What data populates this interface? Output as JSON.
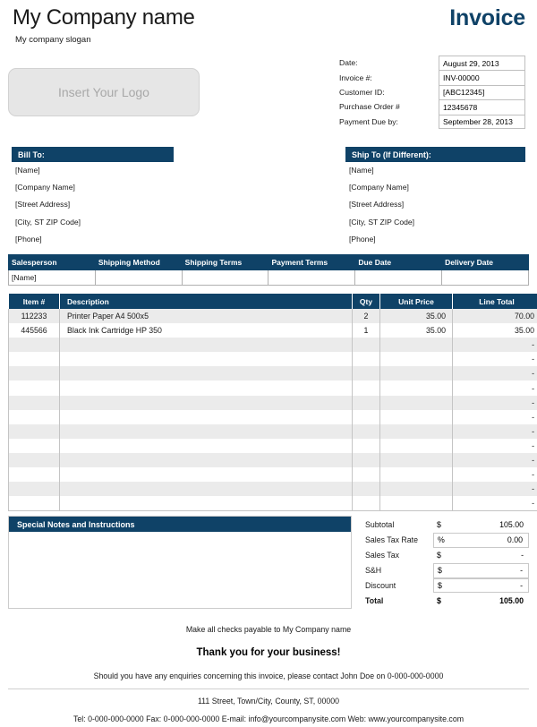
{
  "header": {
    "company_name": "My Company name",
    "company_slogan": "My company slogan",
    "logo_placeholder": "Insert Your Logo",
    "invoice_title": "Invoice"
  },
  "meta": {
    "rows": [
      {
        "label": "Date:",
        "value": "August 29, 2013"
      },
      {
        "label": "Invoice #:",
        "value": "INV-00000"
      },
      {
        "label": "Customer ID:",
        "value": "[ABC12345]"
      },
      {
        "label": "Purchase Order #",
        "value": "12345678"
      },
      {
        "label": "Payment Due by:",
        "value": "September 28, 2013"
      }
    ]
  },
  "bill_to": {
    "heading": "Bill To:",
    "lines": [
      "[Name]",
      "[Company Name]",
      "[Street Address]",
      "[City, ST  ZIP Code]",
      "[Phone]"
    ]
  },
  "ship_to": {
    "heading": "Ship To (If Different):",
    "lines": [
      "[Name]",
      "[Company Name]",
      "[Street Address]",
      "[City, ST  ZIP Code]",
      "[Phone]"
    ]
  },
  "terms": {
    "headers": [
      "Salesperson",
      "Shipping Method",
      "Shipping Terms",
      "Payment Terms",
      "Due Date",
      "Delivery Date"
    ],
    "row": [
      "[Name]",
      "",
      "",
      "",
      "",
      ""
    ]
  },
  "items": {
    "headers": {
      "item": "Item #",
      "description": "Description",
      "qty": "Qty",
      "unit_price": "Unit Price",
      "line_total": "Line Total"
    },
    "rows": [
      {
        "item": "112233",
        "description": "Printer Paper A4 500x5",
        "qty": "2",
        "unit_price": "35.00",
        "line_total": "70.00"
      },
      {
        "item": "445566",
        "description": "Black Ink Cartridge HP 350",
        "qty": "1",
        "unit_price": "35.00",
        "line_total": "35.00"
      },
      {
        "item": "",
        "description": "",
        "qty": "",
        "unit_price": "",
        "line_total": "-"
      },
      {
        "item": "",
        "description": "",
        "qty": "",
        "unit_price": "",
        "line_total": "-"
      },
      {
        "item": "",
        "description": "",
        "qty": "",
        "unit_price": "",
        "line_total": "-"
      },
      {
        "item": "",
        "description": "",
        "qty": "",
        "unit_price": "",
        "line_total": "-"
      },
      {
        "item": "",
        "description": "",
        "qty": "",
        "unit_price": "",
        "line_total": "-"
      },
      {
        "item": "",
        "description": "",
        "qty": "",
        "unit_price": "",
        "line_total": "-"
      },
      {
        "item": "",
        "description": "",
        "qty": "",
        "unit_price": "",
        "line_total": "-"
      },
      {
        "item": "",
        "description": "",
        "qty": "",
        "unit_price": "",
        "line_total": "-"
      },
      {
        "item": "",
        "description": "",
        "qty": "",
        "unit_price": "",
        "line_total": "-"
      },
      {
        "item": "",
        "description": "",
        "qty": "",
        "unit_price": "",
        "line_total": "-"
      },
      {
        "item": "",
        "description": "",
        "qty": "",
        "unit_price": "",
        "line_total": "-"
      },
      {
        "item": "",
        "description": "",
        "qty": "",
        "unit_price": "",
        "line_total": "-"
      }
    ]
  },
  "notes": {
    "heading": "Special Notes and Instructions",
    "body": ""
  },
  "totals": {
    "rows": [
      {
        "label": "Subtotal",
        "symbol": "$",
        "amount": "105.00",
        "boxed": false,
        "grand": false
      },
      {
        "label": "Sales Tax Rate",
        "symbol": "%",
        "amount": "0.00",
        "boxed": true,
        "grand": false
      },
      {
        "label": "Sales Tax",
        "symbol": "$",
        "amount": "-",
        "boxed": false,
        "grand": false
      },
      {
        "label": "S&H",
        "symbol": "$",
        "amount": "-",
        "boxed": true,
        "grand": false
      },
      {
        "label": "Discount",
        "symbol": "$",
        "amount": "-",
        "boxed": true,
        "grand": false
      },
      {
        "label": "Total",
        "symbol": "$",
        "amount": "105.00",
        "boxed": false,
        "grand": true
      }
    ]
  },
  "footer": {
    "payable": "Make all checks payable to My Company name",
    "thanks": "Thank you for your business!",
    "enquiries": "Should you have any enquiries concerning this invoice, please contact John Doe on 0-000-000-0000",
    "address": "111 Street, Town/City, County, ST, 00000",
    "contact": "Tel: 0-000-000-0000 Fax: 0-000-000-0000 E-mail: info@yourcompanysite.com Web: www.yourcompanysite.com"
  },
  "colors": {
    "navy": "#0f4267",
    "row_stripe": "#ebebeb",
    "logo_fill": "#e6e6e6"
  }
}
